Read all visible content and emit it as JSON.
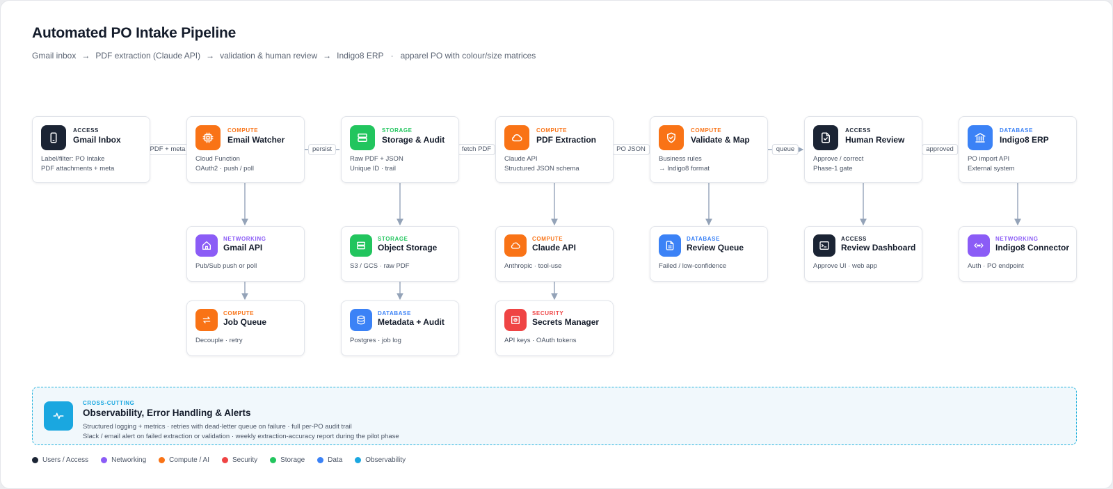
{
  "title": "Automated PO Intake Pipeline",
  "subtitle": {
    "steps": [
      "Gmail inbox",
      "PDF extraction (Claude API)",
      "validation & human review",
      "Indigo8 ERP"
    ],
    "arrow": "→",
    "separator": "·",
    "note": "apparel PO with colour/size matrices"
  },
  "colors": {
    "access": "#1b2434",
    "networking": "#8b5cf6",
    "compute": "#f97316",
    "security": "#ef4444",
    "storage": "#22c55e",
    "database": "#3b82f6",
    "observability": "#1aa7e0",
    "wire": "#94a3b8"
  },
  "nodes": {
    "gmail_inbox": {
      "category": "ACCESS",
      "name": "Gmail Inbox",
      "icon": "phone-icon",
      "desc": [
        "Label/filter: PO Intake",
        "PDF attachments + meta"
      ]
    },
    "email_watcher": {
      "category": "COMPUTE",
      "name": "Email Watcher",
      "icon": "chip-icon",
      "desc": [
        "Cloud Function",
        "OAuth2 · push / poll"
      ]
    },
    "storage_audit": {
      "category": "STORAGE",
      "name": "Storage & Audit",
      "icon": "storage-icon",
      "desc": [
        "Raw PDF + JSON",
        "Unique ID · trail"
      ]
    },
    "pdf_extraction": {
      "category": "COMPUTE",
      "name": "PDF Extraction",
      "icon": "cloud-icon",
      "desc": [
        "Claude API",
        "Structured JSON schema"
      ]
    },
    "validate_map": {
      "category": "COMPUTE",
      "name": "Validate & Map",
      "icon": "shield-check-icon",
      "desc": [
        "Business rules",
        "→ Indigo8 format"
      ]
    },
    "human_review": {
      "category": "ACCESS",
      "name": "Human Review",
      "icon": "file-check-icon",
      "desc": [
        "Approve / correct",
        "Phase-1 gate"
      ]
    },
    "indigo8_erp": {
      "category": "DATABASE",
      "name": "Indigo8 ERP",
      "icon": "bank-icon",
      "desc": [
        "PO import API",
        "External system"
      ]
    },
    "gmail_api": {
      "category": "NETWORKING",
      "name": "Gmail API",
      "icon": "home-icon",
      "desc": [
        "Pub/Sub push or poll"
      ]
    },
    "object_storage": {
      "category": "STORAGE",
      "name": "Object Storage",
      "icon": "storage-icon",
      "desc": [
        "S3 / GCS · raw PDF"
      ]
    },
    "claude_api": {
      "category": "COMPUTE",
      "name": "Claude API",
      "icon": "cloud-icon",
      "desc": [
        "Anthropic · tool-use"
      ]
    },
    "review_queue": {
      "category": "DATABASE",
      "name": "Review Queue",
      "icon": "document-icon",
      "desc": [
        "Failed / low-confidence"
      ]
    },
    "review_dashboard": {
      "category": "ACCESS",
      "name": "Review Dashboard",
      "icon": "terminal-icon",
      "desc": [
        "Approve UI · web app"
      ]
    },
    "indigo8_connector": {
      "category": "NETWORKING",
      "name": "Indigo8 Connector",
      "icon": "connector-icon",
      "desc": [
        "Auth · PO endpoint"
      ]
    },
    "job_queue": {
      "category": "COMPUTE",
      "name": "Job Queue",
      "icon": "swap-icon",
      "desc": [
        "Decouple · retry"
      ]
    },
    "metadata_audit": {
      "category": "DATABASE",
      "name": "Metadata + Audit",
      "icon": "database-icon",
      "desc": [
        "Postgres · job log"
      ]
    },
    "secrets_manager": {
      "category": "SECURITY",
      "name": "Secrets Manager",
      "icon": "safe-icon",
      "desc": [
        "API keys · OAuth tokens"
      ]
    }
  },
  "edges": {
    "pdf_meta": "PDF + meta",
    "persist": "persist",
    "fetch_pdf": "fetch PDF",
    "po_json": "PO JSON",
    "queue": "queue",
    "approved": "approved"
  },
  "observability": {
    "category": "CROSS-CUTTING",
    "name": "Observability, Error Handling & Alerts",
    "icon": "pulse-icon",
    "desc": [
      "Structured logging + metrics · retries with dead-letter queue on failure · full per-PO audit trail",
      "Slack / email alert on failed extraction or validation · weekly extraction-accuracy report during the pilot phase"
    ]
  },
  "legend": [
    {
      "label": "Users / Access",
      "color": "#1b2434"
    },
    {
      "label": "Networking",
      "color": "#8b5cf6"
    },
    {
      "label": "Compute / AI",
      "color": "#f97316"
    },
    {
      "label": "Security",
      "color": "#ef4444"
    },
    {
      "label": "Storage",
      "color": "#22c55e"
    },
    {
      "label": "Data",
      "color": "#3b82f6"
    },
    {
      "label": "Observability",
      "color": "#1aa7e0"
    }
  ]
}
